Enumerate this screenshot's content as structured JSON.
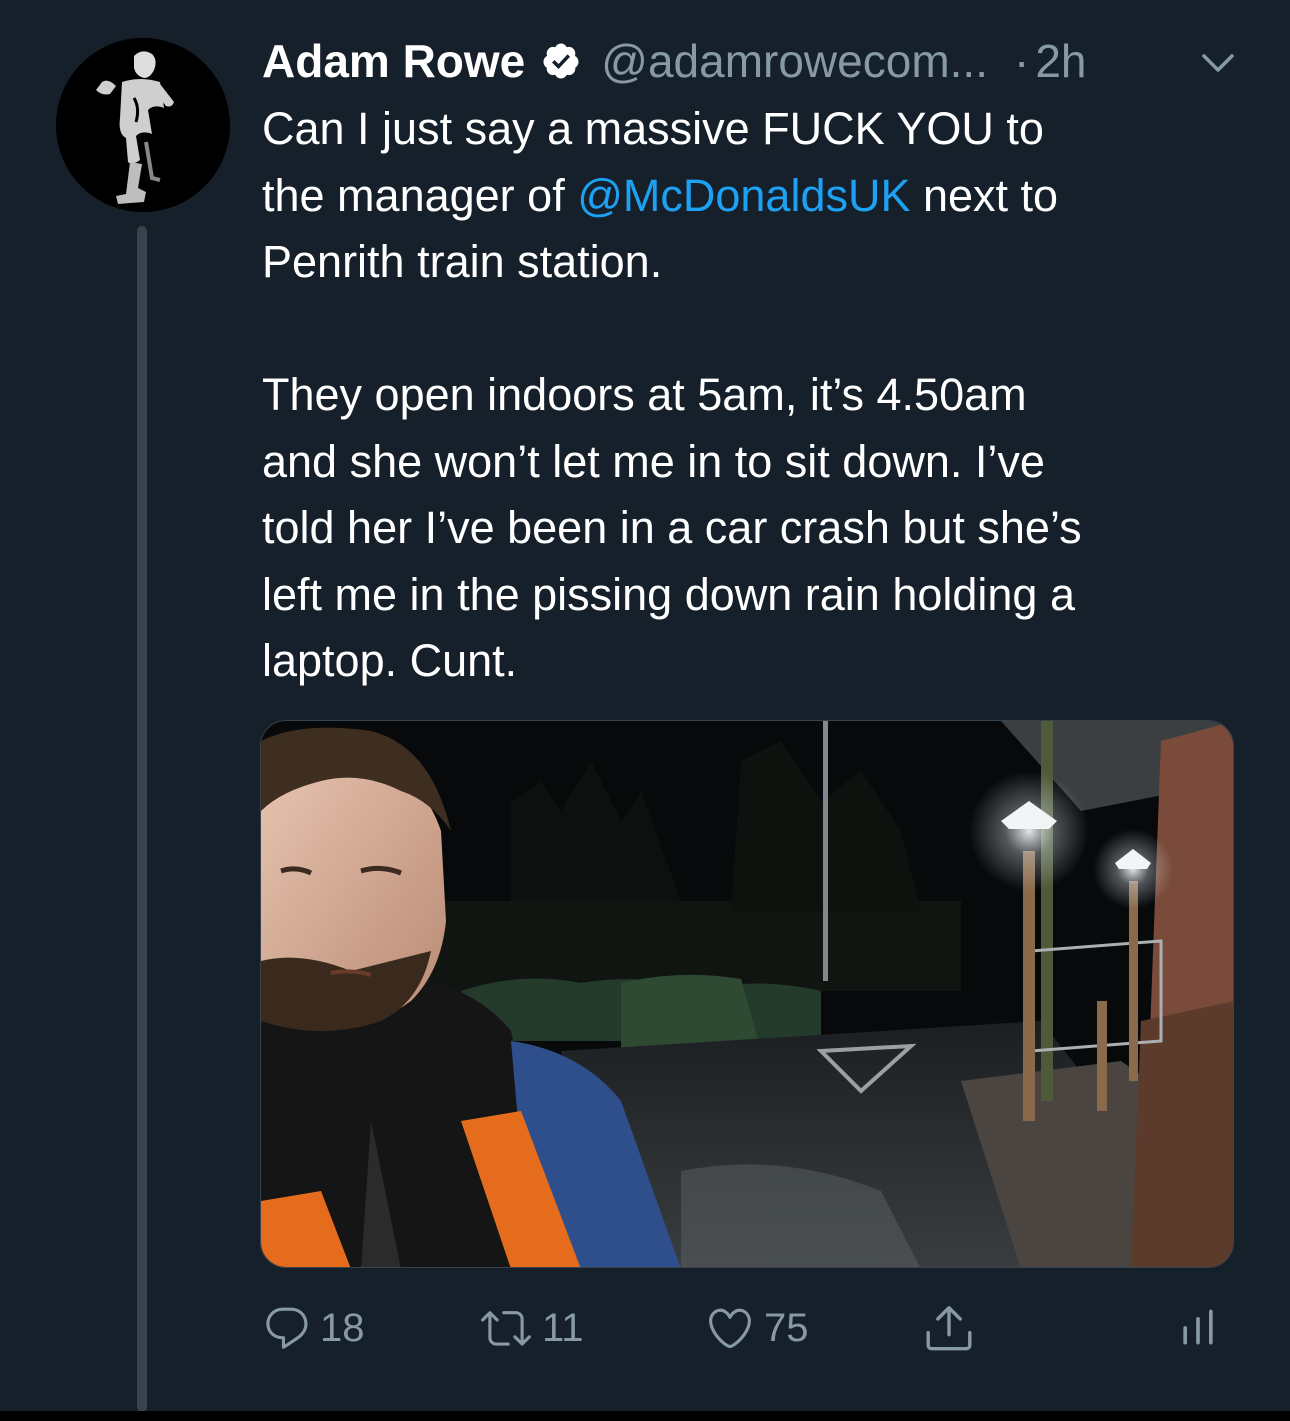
{
  "tweet": {
    "author_name": "Adam Rowe",
    "handle": "@adamrowecom...",
    "separator": "·",
    "time": "2h",
    "text_lines": [
      [
        "Can I just say a massive FUCK YOU to"
      ],
      [
        "the manager of ",
        "@McDonaldsUK",
        " next to"
      ],
      [
        "Penrith train station."
      ],
      [],
      [
        "They open indoors at 5am, it’s 4.50am"
      ],
      [
        "and she won’t let me in to sit down. I’ve"
      ],
      [
        "told her I’ve been in a car crash but she’s"
      ],
      [
        "left me in the pissing down rain holding a"
      ],
      [
        "laptop. Cunt."
      ]
    ],
    "line1": "Can I just say a massive FUCK YOU to",
    "line2_pre": "the manager of ",
    "line2_mention": "@McDonaldsUK",
    "line2_post": " next to",
    "line3": "Penrith train station.",
    "line5": "They open indoors at 5am, it’s 4.50am",
    "line6": "and she won’t let me in to sit down. I’ve",
    "line7": "told her I’ve been in a car crash but she’s",
    "line8": "left me in the pissing down rain holding a",
    "line9": "laptop. Cunt."
  },
  "actions": {
    "replies": "18",
    "retweets": "11",
    "likes": "75"
  },
  "icons": {
    "verified": "verified-badge-icon",
    "more": "chevron-down-icon",
    "reply": "reply-icon",
    "retweet": "retweet-icon",
    "like": "heart-icon",
    "share": "share-icon",
    "analytics": "analytics-icon"
  },
  "colors": {
    "background": "#15202b",
    "text": "#ffffff",
    "secondary": "#8899a6",
    "accent": "#1da1f2",
    "thread_line": "#38444d"
  }
}
